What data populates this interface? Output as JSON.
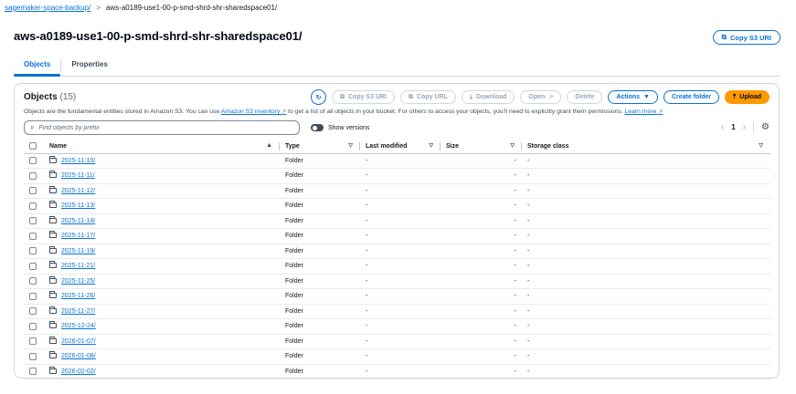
{
  "breadcrumb": {
    "parent": "sagemaker-space-backup/",
    "separator": ">",
    "current": "aws-a0189-use1-00-p-smd-shrd-shr-sharedspace01/"
  },
  "page_title": "aws-a0189-use1-00-p-smd-shrd-shr-sharedspace01/",
  "copy_s3_uri_top": "Copy S3 URI",
  "tabs": [
    {
      "label": "Objects",
      "active": true
    },
    {
      "label": "Properties",
      "active": false
    }
  ],
  "objects_panel": {
    "title": "Objects",
    "count": "(15)",
    "toolbar": {
      "copy_s3_uri": "Copy S3 URI",
      "copy_url": "Copy URL",
      "download": "Download",
      "open": "Open",
      "delete": "Delete",
      "actions": "Actions",
      "create_folder": "Create folder",
      "upload": "Upload"
    },
    "description": {
      "part1": "Objects are the fundamental entities stored in Amazon S3. You can use ",
      "inventory_link": "Amazon S3 inventory",
      "part2": " to get a list of all objects in your bucket. For others to access your objects, you’ll need to explicitly grant them permissions. ",
      "learn_more": "Learn more"
    },
    "search_placeholder": "Find objects by prefix",
    "show_versions": "Show versions",
    "pagination": {
      "current_page": "1"
    },
    "columns": {
      "name": "Name",
      "type": "Type",
      "last_modified": "Last modified",
      "size": "Size",
      "storage_class": "Storage class"
    },
    "rows": [
      {
        "name": "2025-11-10/",
        "type": "Folder",
        "last_modified": "-",
        "size": "-",
        "storage_class": "-"
      },
      {
        "name": "2025-11-11/",
        "type": "Folder",
        "last_modified": "-",
        "size": "-",
        "storage_class": "-"
      },
      {
        "name": "2025-11-12/",
        "type": "Folder",
        "last_modified": "-",
        "size": "-",
        "storage_class": "-"
      },
      {
        "name": "2025-11-13/",
        "type": "Folder",
        "last_modified": "-",
        "size": "-",
        "storage_class": "-"
      },
      {
        "name": "2025-11-14/",
        "type": "Folder",
        "last_modified": "-",
        "size": "-",
        "storage_class": "-"
      },
      {
        "name": "2025-11-17/",
        "type": "Folder",
        "last_modified": "-",
        "size": "-",
        "storage_class": "-"
      },
      {
        "name": "2025-11-19/",
        "type": "Folder",
        "last_modified": "-",
        "size": "-",
        "storage_class": "-"
      },
      {
        "name": "2025-11-21/",
        "type": "Folder",
        "last_modified": "-",
        "size": "-",
        "storage_class": "-"
      },
      {
        "name": "2025-11-25/",
        "type": "Folder",
        "last_modified": "-",
        "size": "-",
        "storage_class": "-"
      },
      {
        "name": "2025-11-26/",
        "type": "Folder",
        "last_modified": "-",
        "size": "-",
        "storage_class": "-"
      },
      {
        "name": "2025-11-27/",
        "type": "Folder",
        "last_modified": "-",
        "size": "-",
        "storage_class": "-"
      },
      {
        "name": "2025-12-24/",
        "type": "Folder",
        "last_modified": "-",
        "size": "-",
        "storage_class": "-"
      },
      {
        "name": "2026-01-07/",
        "type": "Folder",
        "last_modified": "-",
        "size": "-",
        "storage_class": "-"
      },
      {
        "name": "2026-01-08/",
        "type": "Folder",
        "last_modified": "-",
        "size": "-",
        "storage_class": "-"
      },
      {
        "name": "2026-02-02/",
        "type": "Folder",
        "last_modified": "-",
        "size": "-",
        "storage_class": "-"
      }
    ]
  },
  "colors": {
    "link": "#0972d3",
    "upload": "#ff9900",
    "border": "#d1d5db",
    "text": "#16191f"
  }
}
